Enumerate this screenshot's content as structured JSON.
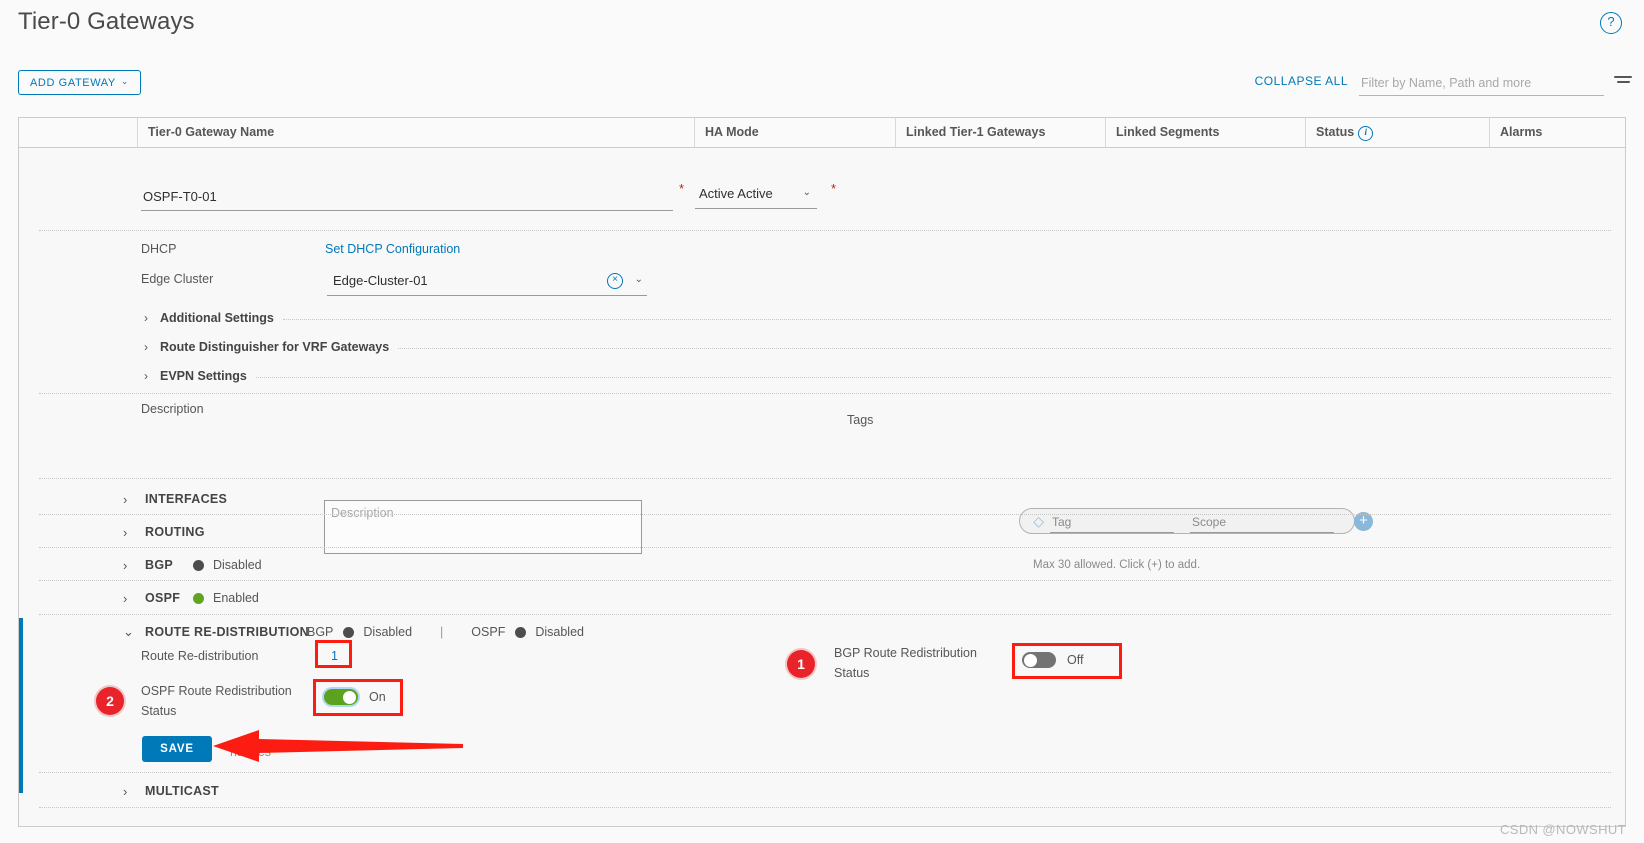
{
  "header": {
    "title": "Tier-0 Gateways",
    "help_icon": "?"
  },
  "toolbar": {
    "add_gateway_label": "ADD GATEWAY",
    "add_gateway_caret": "⌄",
    "collapse_all_label": "COLLAPSE ALL",
    "filter_placeholder": "Filter by Name, Path and more",
    "filter_value": ""
  },
  "table": {
    "columns": [
      {
        "label": "Tier-0 Gateway Name"
      },
      {
        "label": "HA Mode"
      },
      {
        "label": "Linked Tier-1 Gateways"
      },
      {
        "label": "Linked Segments"
      },
      {
        "label": "Status",
        "has_info": true
      },
      {
        "label": "Alarms"
      }
    ]
  },
  "gateway": {
    "name_value": "OSPF-T0-01",
    "name_required_mark": "*",
    "ha_mode_value": "Active Active",
    "ha_mode_required_mark": "*",
    "chevron_down": "⌄",
    "dhcp_label": "DHCP",
    "dhcp_link": "Set DHCP Configuration",
    "edge_cluster_label": "Edge Cluster",
    "edge_cluster_value": "Edge-Cluster-01",
    "clear_glyph": "×",
    "sub_sections": [
      {
        "label": "Additional Settings"
      },
      {
        "label": "Route Distinguisher for VRF Gateways"
      },
      {
        "label": "EVPN Settings"
      }
    ],
    "description_label": "Description",
    "description_value": "",
    "description_placeholder": "Description",
    "tags_label": "Tags",
    "tag_placeholder": "Tag",
    "tag_value": "",
    "scope_placeholder": "Scope",
    "scope_value": "",
    "tag_add_glyph": "+",
    "tags_hint": "Max 30 allowed. Click (+) to add."
  },
  "sections": [
    {
      "name": "INTERFACES",
      "chevron": "›",
      "state": "",
      "state_color": ""
    },
    {
      "name": "ROUTING",
      "chevron": "›",
      "state": "",
      "state_color": ""
    },
    {
      "name": "BGP",
      "chevron": "›",
      "state": "Disabled",
      "state_color": "#4d4d4d"
    },
    {
      "name": "OSPF",
      "chevron": "›",
      "state": "Enabled",
      "state_color": "#62a420"
    }
  ],
  "route_redistribution": {
    "title": "ROUTE RE-DISTRIBUTION",
    "chevron": "⌄",
    "bgp_label": "BGP",
    "bgp_state": "Disabled",
    "bgp_state_color": "#4d4d4d",
    "separator": "|",
    "ospf_label": "OSPF",
    "ospf_state": "Disabled",
    "ospf_state_color": "#4d4d4d",
    "route_redistribution_label": "Route Re-distribution",
    "route_redistribution_count": "1",
    "ospf_status_label": "OSPF Route Redistribution Status",
    "ospf_status_toggle": "On",
    "bgp_status_label": "BGP Route Redistribution Status",
    "bgp_status_toggle": "Off",
    "badge_one": "1",
    "badge_two": "2"
  },
  "footer": {
    "save_label": "SAVE",
    "ghost_label": "hanges",
    "multicast_label": "MULTICAST",
    "multicast_chevron": "›"
  },
  "watermark": "CSDN @NOWSHUT",
  "colors": {
    "accent": "#0079b8",
    "enabled": "#62a420",
    "disabled": "#4d4d4d",
    "annotation_red": "#fc1c12",
    "badge_red": "#e8232a",
    "required": "#c92100"
  }
}
